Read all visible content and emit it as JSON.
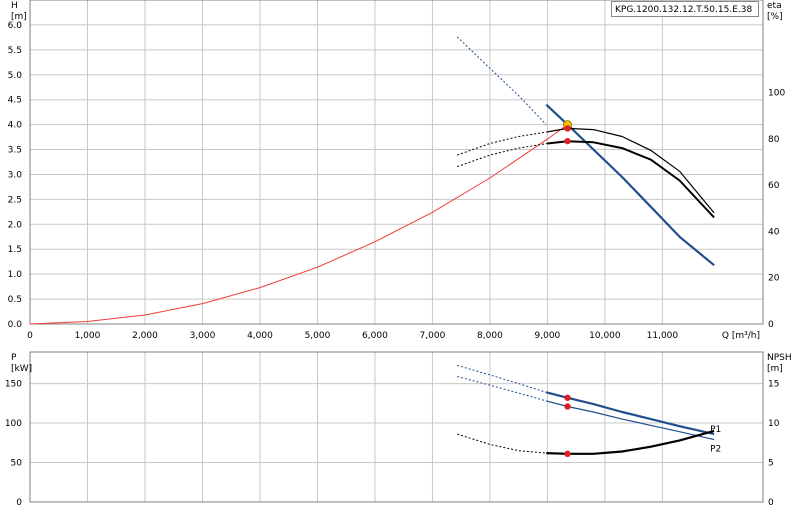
{
  "model_label": "KPG.1200.132.12.T.50.15.E.38",
  "colors": {
    "system_curve": "#f03c3c",
    "pump_curve": "#1f4e8c",
    "efficiency": "#000000",
    "marker_red": "#e02020",
    "duty_point": "#f5c400",
    "grid": "#c8c8c8"
  },
  "chart_data": [
    {
      "type": "line",
      "title": "",
      "xlabel": "Q [m³/h]",
      "ylabel": "H\n[m]",
      "y2label": "eta\n[%]",
      "xlim": [
        0,
        12750
      ],
      "ylim": [
        0,
        6.5
      ],
      "y2lim": [
        0,
        140
      ],
      "x_ticks": [
        0,
        1000,
        2000,
        3000,
        4000,
        5000,
        6000,
        7000,
        8000,
        9000,
        10000,
        11000
      ],
      "x_tick_labels": [
        "0",
        "1,000",
        "2,000",
        "3,000",
        "4,000",
        "5,000",
        "6,000",
        "7,000",
        "8,000",
        "9,000",
        "10,000",
        "11,000"
      ],
      "y_ticks": [
        0.0,
        0.5,
        1.0,
        1.5,
        2.0,
        2.5,
        3.0,
        3.5,
        4.0,
        4.5,
        5.0,
        5.5,
        6.0
      ],
      "y_tick_labels": [
        "0.0",
        "0.5",
        "1.0",
        "1.5",
        "2.0",
        "2.5",
        "3.0",
        "3.5",
        "4.0",
        "4.5",
        "5.0",
        "5.5",
        "6.0"
      ],
      "y2_ticks": [
        0,
        20,
        40,
        60,
        80,
        100
      ],
      "y2_tick_labels": [
        "0",
        "20",
        "40",
        "60",
        "80",
        "100"
      ],
      "grid": true,
      "series": [
        {
          "role": "system_curve",
          "axis": "y",
          "style": "solid",
          "x": [
            0,
            1000,
            2000,
            3000,
            4000,
            5000,
            6000,
            7000,
            8000,
            9000,
            9350
          ],
          "y": [
            0,
            0.05,
            0.18,
            0.41,
            0.73,
            1.14,
            1.65,
            2.24,
            2.93,
            3.71,
            4.0
          ]
        },
        {
          "role": "pump_curve",
          "axis": "y",
          "style": "dashed",
          "x": [
            7430,
            8000,
            8500,
            8980
          ],
          "y": [
            5.76,
            5.13,
            4.58,
            4.0
          ]
        },
        {
          "role": "pump_curve",
          "axis": "y",
          "style": "solid",
          "x": [
            8980,
            9350,
            9800,
            10300,
            10800,
            11300,
            11900
          ],
          "y": [
            4.4,
            4.0,
            3.5,
            2.95,
            2.35,
            1.75,
            1.18
          ]
        },
        {
          "role": "efficiency_upper",
          "axis": "y2",
          "style": "dashed",
          "x": [
            7430,
            8000,
            8500,
            9000
          ],
          "y": [
            73,
            78,
            81,
            83
          ]
        },
        {
          "role": "efficiency_upper",
          "axis": "y2",
          "style": "solid",
          "x": [
            9000,
            9350,
            9800,
            10300,
            10800,
            11300,
            11900
          ],
          "y": [
            83,
            84.5,
            84,
            81,
            75,
            66,
            48
          ]
        },
        {
          "role": "efficiency_lower",
          "axis": "y2",
          "style": "dashed",
          "x": [
            7430,
            8000,
            8500,
            9000
          ],
          "y": [
            68,
            73,
            76,
            78
          ]
        },
        {
          "role": "efficiency_lower",
          "axis": "y2",
          "style": "solid",
          "x": [
            9000,
            9350,
            9800,
            10300,
            10800,
            11300,
            11900
          ],
          "y": [
            78,
            79,
            78.5,
            76,
            71,
            62,
            46
          ]
        }
      ],
      "markers": [
        {
          "role": "duty_point",
          "axis": "y",
          "x": 9350,
          "y": 4.0
        },
        {
          "role": "eff_point",
          "axis": "y2",
          "x": 9350,
          "y": 84.5
        },
        {
          "role": "eff_point",
          "axis": "y2",
          "x": 9350,
          "y": 79
        }
      ]
    },
    {
      "type": "line",
      "title": "",
      "ylabel": "P\n[kW]",
      "y2label": "NPSH\n[m]",
      "xlim": [
        0,
        12750
      ],
      "ylim": [
        0,
        190
      ],
      "y2lim": [
        0,
        19
      ],
      "y_ticks": [
        0,
        50,
        100,
        150
      ],
      "y_tick_labels": [
        "0",
        "50",
        "100",
        "150"
      ],
      "y2_ticks": [
        0,
        5,
        10,
        15
      ],
      "y2_tick_labels": [
        "0",
        "5",
        "10",
        "15"
      ],
      "grid": true,
      "series": [
        {
          "name": "P1",
          "axis": "y",
          "style": "dashed",
          "x": [
            7430,
            8000,
            8500,
            8980
          ],
          "y": [
            173,
            161,
            150,
            139
          ]
        },
        {
          "name": "P1",
          "axis": "y",
          "style": "solid",
          "x": [
            8980,
            9350,
            9800,
            10300,
            10800,
            11300,
            11900
          ],
          "y": [
            139,
            132,
            124,
            114,
            105,
            96,
            86
          ]
        },
        {
          "name": "P2",
          "axis": "y",
          "style": "dashed",
          "x": [
            7430,
            8000,
            8500,
            8980
          ],
          "y": [
            159,
            148,
            138,
            128
          ]
        },
        {
          "name": "P2",
          "axis": "y",
          "style": "solid",
          "x": [
            8980,
            9350,
            9800,
            10300,
            10800,
            11300,
            11900
          ],
          "y": [
            128,
            121,
            114,
            105,
            97,
            89,
            79
          ]
        },
        {
          "role": "NPSH",
          "axis": "y2",
          "style": "dashed",
          "x": [
            7430,
            8000,
            8500,
            8980
          ],
          "y": [
            8.6,
            7.3,
            6.5,
            6.2
          ]
        },
        {
          "role": "NPSH",
          "axis": "y2",
          "style": "solid",
          "x": [
            8980,
            9350,
            9800,
            10300,
            10800,
            11300,
            11900
          ],
          "y": [
            6.2,
            6.1,
            6.1,
            6.4,
            7.0,
            7.8,
            9.0
          ]
        }
      ],
      "markers": [
        {
          "role": "P1_point",
          "axis": "y",
          "x": 9350,
          "y": 132
        },
        {
          "role": "P2_point",
          "axis": "y",
          "x": 9350,
          "y": 121
        },
        {
          "role": "NPSH_point",
          "axis": "y2",
          "x": 9350,
          "y": 6.1
        }
      ],
      "labels": [
        "P1",
        "P2"
      ]
    }
  ]
}
